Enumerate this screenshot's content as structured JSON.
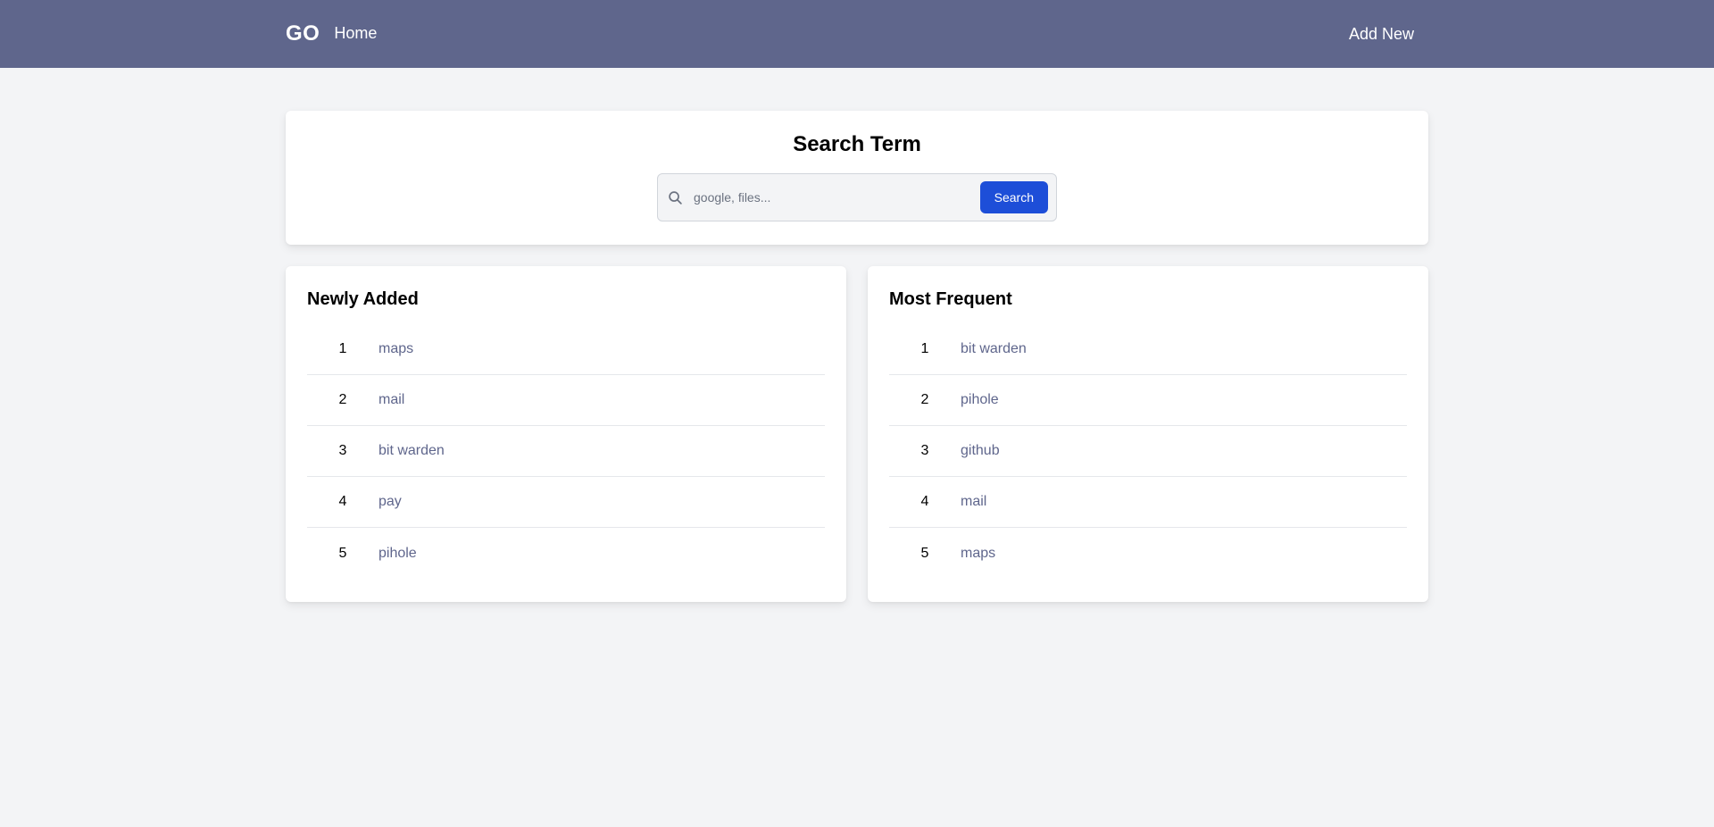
{
  "navbar": {
    "brand": "GO",
    "home_label": "Home",
    "add_new_label": "Add New"
  },
  "search": {
    "title": "Search Term",
    "placeholder": "google, files...",
    "button_label": "Search"
  },
  "newly_added": {
    "title": "Newly Added",
    "items": [
      {
        "rank": "1",
        "name": "maps"
      },
      {
        "rank": "2",
        "name": "mail"
      },
      {
        "rank": "3",
        "name": "bit warden"
      },
      {
        "rank": "4",
        "name": "pay"
      },
      {
        "rank": "5",
        "name": "pihole"
      }
    ]
  },
  "most_frequent": {
    "title": "Most Frequent",
    "items": [
      {
        "rank": "1",
        "name": "bit warden"
      },
      {
        "rank": "2",
        "name": "pihole"
      },
      {
        "rank": "3",
        "name": "github"
      },
      {
        "rank": "4",
        "name": "mail"
      },
      {
        "rank": "5",
        "name": "maps"
      }
    ]
  },
  "colors": {
    "navbar_bg": "#5f668c",
    "accent_button": "#1d4ed8",
    "link_text": "#5f668c",
    "page_bg": "#f3f4f6"
  },
  "icons": {
    "search": "search-icon"
  }
}
